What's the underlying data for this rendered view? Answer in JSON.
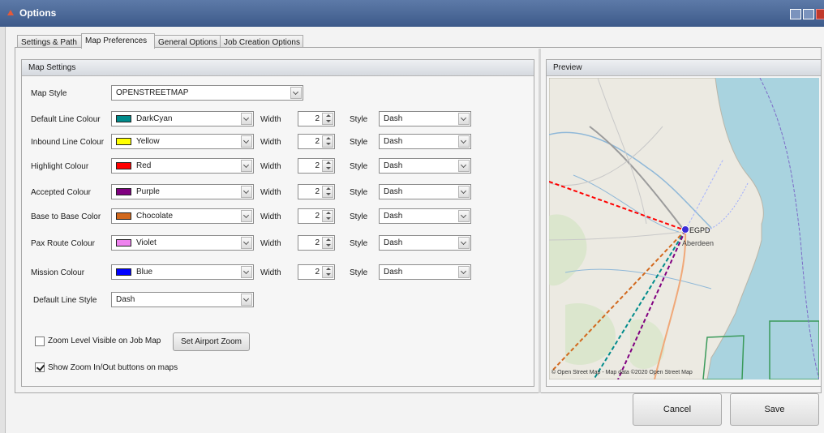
{
  "window": {
    "title": "Options"
  },
  "tabs": [
    {
      "label": "Settings & Path"
    },
    {
      "label": "Map Preferences"
    },
    {
      "label": "General Options"
    },
    {
      "label": "Job Creation Options"
    }
  ],
  "map_settings": {
    "header": "Map Settings",
    "map_style_label": "Map Style",
    "map_style_value": "OPENSTREETMAP",
    "width_label": "Width",
    "style_label": "Style",
    "rows": [
      {
        "label": "Default Line Colour",
        "color_name": "DarkCyan",
        "color": "#008b8b",
        "width": "2",
        "style": "Dash"
      },
      {
        "label": "Inbound Line Colour",
        "color_name": "Yellow",
        "color": "#ffff00",
        "width": "2",
        "style": "Dash"
      },
      {
        "label": "Highlight Colour",
        "color_name": "Red",
        "color": "#ff0000",
        "width": "2",
        "style": "Dash"
      },
      {
        "label": "Accepted Colour",
        "color_name": "Purple",
        "color": "#800080",
        "width": "2",
        "style": "Dash"
      },
      {
        "label": "Base to Base Color",
        "color_name": "Chocolate",
        "color": "#d2691e",
        "width": "2",
        "style": "Dash"
      },
      {
        "label": "Pax Route Colour",
        "color_name": "Violet",
        "color": "#ee82ee",
        "width": "2",
        "style": "Dash"
      },
      {
        "label": "Mission Colour",
        "color_name": "Blue",
        "color": "#0000ff",
        "width": "2",
        "style": "Dash"
      }
    ],
    "default_line_style_label": "Default Line Style",
    "default_line_style_value": "Dash",
    "zoom_visible_label": "Zoom Level Visible on Job Map",
    "zoom_visible_checked": false,
    "set_airport_zoom_label": "Set Airport Zoom",
    "show_zoom_buttons_label": "Show Zoom In/Out buttons on maps",
    "show_zoom_buttons_checked": true
  },
  "preview": {
    "header": "Preview",
    "airport_code": "EGPD",
    "city_label": "Aberdeen",
    "attribution": "© Open Street Map - Map data ©2020 Open Street Map"
  },
  "footer": {
    "cancel_label": "Cancel",
    "save_label": "Save"
  }
}
